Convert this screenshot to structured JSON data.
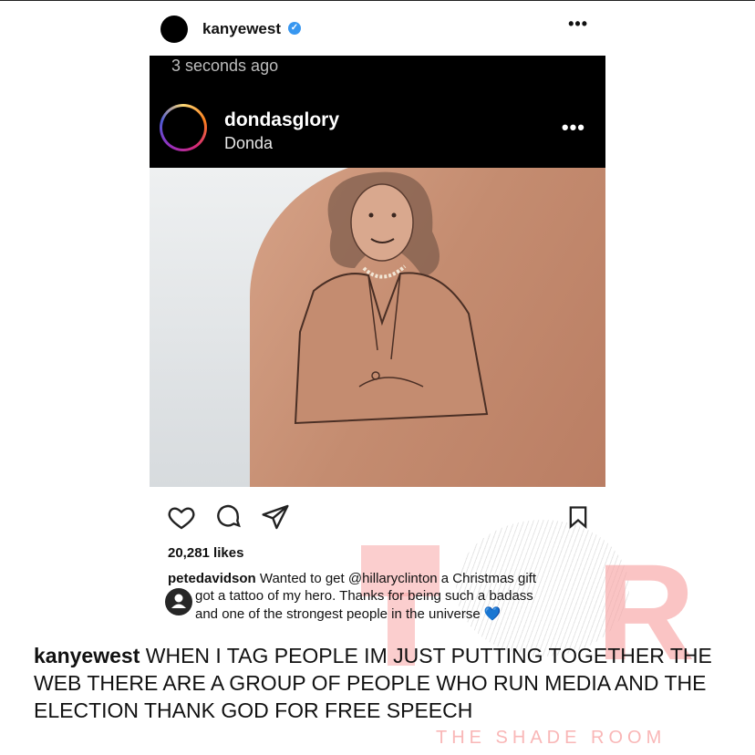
{
  "outer": {
    "username": "kanyewest",
    "verified_mark": "✓",
    "more": "•••"
  },
  "repost": {
    "time": "3 seconds ago",
    "username": "dondasglory",
    "subtitle": "Donda",
    "more": "•••"
  },
  "icons": [
    "heart-icon",
    "comment-icon",
    "share-icon",
    "bookmark-icon",
    "person-icon"
  ],
  "post": {
    "likes": "20,281 likes",
    "caption_user": "petedavidson",
    "caption_lines": [
      "Wanted to get @hillaryclinton a Christmas gift",
      "got a tattoo of my hero. Thanks for being such a badass",
      "and one of the strongest people in the universe 💙"
    ]
  },
  "kanye_caption": {
    "username": "kanyewest",
    "text": "WHEN I TAG PEOPLE IM JUST PUTTING TOGETHER THE WEB  THERE ARE A GROUP OF PEOPLE WHO RUN MEDIA  AND THE ELECTION  THANK GOD FOR FREE SPEECH"
  },
  "watermark": {
    "letter_r": "R",
    "brand": "THE SHADE ROOM"
  },
  "colors": {
    "verified": "#3897f0",
    "watermark": "#f7a5a5",
    "screenshot_header": "#000000"
  }
}
